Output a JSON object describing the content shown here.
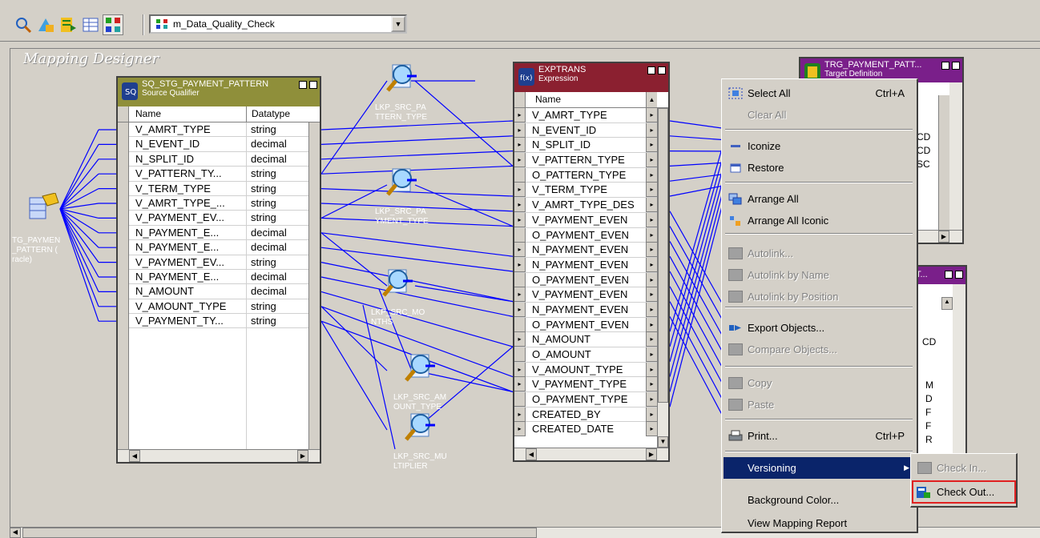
{
  "toolbar": {
    "icons": [
      "find-icon",
      "source-analyzer-icon",
      "target-designer-icon",
      "transformation-developer-icon",
      "mapping-designer-icon"
    ],
    "mapping_combo": "m_Data_Quality_Check"
  },
  "canvas": {
    "title": "Mapping Designer",
    "source_label": [
      "TG_PAYMEN",
      "_PATTERN (",
      "racle)"
    ]
  },
  "sq": {
    "title": "SQ_STG_PAYMENT_PATTERN",
    "subtitle": "Source Qualifier",
    "col_name": "Name",
    "col_type": "Datatype",
    "rows": [
      {
        "name": "V_AMRT_TYPE",
        "type": "string"
      },
      {
        "name": "N_EVENT_ID",
        "type": "decimal"
      },
      {
        "name": "N_SPLIT_ID",
        "type": "decimal"
      },
      {
        "name": "V_PATTERN_TY...",
        "type": "string"
      },
      {
        "name": "V_TERM_TYPE",
        "type": "string"
      },
      {
        "name": "V_AMRT_TYPE_...",
        "type": "string"
      },
      {
        "name": "V_PAYMENT_EV...",
        "type": "string"
      },
      {
        "name": "N_PAYMENT_E...",
        "type": "decimal"
      },
      {
        "name": "N_PAYMENT_E...",
        "type": "decimal"
      },
      {
        "name": "V_PAYMENT_EV...",
        "type": "string"
      },
      {
        "name": "N_PAYMENT_E...",
        "type": "decimal"
      },
      {
        "name": "N_AMOUNT",
        "type": "decimal"
      },
      {
        "name": "V_AMOUNT_TYPE",
        "type": "string"
      },
      {
        "name": "V_PAYMENT_TY...",
        "type": "string"
      }
    ]
  },
  "lookups": [
    [
      "LKP_SRC_PA",
      "TTERN_TYPE"
    ],
    [
      "LKP_SRC_PA",
      "YMENT_TYPE"
    ],
    [
      "LKP_SRC_MO",
      "NTHS"
    ],
    [
      "LKP_SRC_AM",
      "OUNT_TYPE"
    ],
    [
      "LKP_SRC_MU",
      "LTIPLIER"
    ]
  ],
  "exp": {
    "title": "EXPTRANS",
    "subtitle": "Expression",
    "col_name": "Name",
    "rows": [
      "V_AMRT_TYPE",
      "N_EVENT_ID",
      "N_SPLIT_ID",
      "V_PATTERN_TYPE",
      "O_PATTERN_TYPE",
      "V_TERM_TYPE",
      "V_AMRT_TYPE_DES",
      "V_PAYMENT_EVEN",
      "O_PAYMENT_EVEN",
      "N_PAYMENT_EVEN",
      "N_PAYMENT_EVEN",
      "O_PAYMENT_EVEN",
      "V_PAYMENT_EVEN",
      "N_PAYMENT_EVEN",
      "O_PAYMENT_EVEN",
      "N_AMOUNT",
      "O_AMOUNT",
      "V_AMOUNT_TYPE",
      "V_PAYMENT_TYPE",
      "O_PAYMENT_TYPE",
      "CREATED_BY",
      "CREATED_DATE"
    ]
  },
  "trg": {
    "title": "TRG_PAYMENT_PATT...",
    "subtitle": "Target Definition",
    "rows": [
      "CD",
      "CD",
      "SC"
    ]
  },
  "trg2": {
    "title": "T...",
    "rows": [
      "CD",
      "M",
      "D",
      "F",
      "F",
      "R"
    ]
  },
  "menu": {
    "items": [
      {
        "label": "Select All",
        "shortcut": "Ctrl+A",
        "icon": "select-all-icon",
        "disabled": false
      },
      {
        "label": "Clear All",
        "shortcut": "",
        "icon": "",
        "disabled": true
      },
      {
        "label": "Iconize",
        "shortcut": "",
        "icon": "iconize-icon",
        "disabled": false
      },
      {
        "label": "Restore",
        "shortcut": "",
        "icon": "restore-icon",
        "disabled": false
      },
      {
        "label": "Arrange All",
        "shortcut": "",
        "icon": "arrange-all-icon",
        "disabled": false
      },
      {
        "label": "Arrange All Iconic",
        "shortcut": "",
        "icon": "arrange-iconic-icon",
        "disabled": false
      },
      {
        "label": "Autolink...",
        "shortcut": "",
        "icon": "autolink-icon",
        "disabled": true
      },
      {
        "label": "Autolink by Name",
        "shortcut": "",
        "icon": "autolink-name-icon",
        "disabled": true
      },
      {
        "label": "Autolink by Position",
        "shortcut": "",
        "icon": "autolink-position-icon",
        "disabled": true
      },
      {
        "label": "Export Objects...",
        "shortcut": "",
        "icon": "export-objects-icon",
        "disabled": false
      },
      {
        "label": "Compare Objects...",
        "shortcut": "",
        "icon": "compare-objects-icon",
        "disabled": true
      },
      {
        "label": "Copy",
        "shortcut": "",
        "icon": "copy-icon",
        "disabled": true
      },
      {
        "label": "Paste",
        "shortcut": "",
        "icon": "paste-icon",
        "disabled": true
      },
      {
        "label": "Print...",
        "shortcut": "Ctrl+P",
        "icon": "print-icon",
        "disabled": false
      },
      {
        "label": "Versioning",
        "shortcut": "",
        "icon": "",
        "disabled": false
      },
      {
        "label": "Background Color...",
        "shortcut": "",
        "icon": "",
        "disabled": false
      },
      {
        "label": "View Mapping Report",
        "shortcut": "",
        "icon": "",
        "disabled": false
      }
    ]
  },
  "submenu": {
    "check_in": "Check In...",
    "check_out": "Check Out..."
  },
  "colors": {
    "link": "#0000ff",
    "sq_header": "#8f8f3a",
    "exp_header": "#8b2030",
    "trg_header": "#7a1f8a",
    "menu_highlight": "#0a246a",
    "checkout_outline": "#e02020"
  }
}
